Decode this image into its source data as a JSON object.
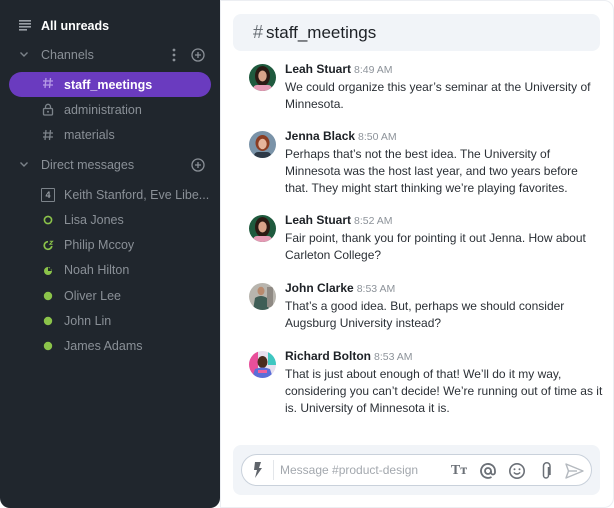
{
  "sidebar": {
    "all_unreads": {
      "label": "All unreads",
      "icon": "list-lines-icon"
    },
    "channels_section": {
      "label": "Channels",
      "icon": "chevron-down-icon"
    },
    "channels": [
      {
        "label": "staff_meetings",
        "icon": "hash-icon",
        "active": true
      },
      {
        "label": "administration",
        "icon": "lock-icon",
        "active": false
      },
      {
        "label": "materials",
        "icon": "hash-icon",
        "active": false
      }
    ],
    "dm_section": {
      "label": "Direct messages",
      "icon": "chevron-down-icon"
    },
    "direct_messages": [
      {
        "label": "Keith Stanford, Eve Libe...",
        "icon": "group-count-icon",
        "badge": "4"
      },
      {
        "label": "Lisa Jones",
        "icon": "status-away-ring-icon"
      },
      {
        "label": "Philip Mccoy",
        "icon": "status-snooze-icon"
      },
      {
        "label": "Noah Hilton",
        "icon": "status-dnd-icon"
      },
      {
        "label": "Oliver Lee",
        "icon": "status-online-dot-icon"
      },
      {
        "label": "John Lin",
        "icon": "status-online-dot-icon"
      },
      {
        "label": "James Adams",
        "icon": "status-online-dot-icon"
      }
    ]
  },
  "channel_header": {
    "hash": "#",
    "title": "staff_meetings"
  },
  "messages": [
    {
      "author": "Leah Stuart",
      "time": "8:49 AM",
      "lines": [
        "We could organize this year’s seminar at the University of",
        "Minnesota."
      ]
    },
    {
      "author": "Jenna Black",
      "time": "8:50 AM",
      "lines": [
        "Perhaps that’s not the best idea. The University of",
        "Minnesota was the host last year, and two years before",
        "that. They might start thinking we’re playing favorites."
      ]
    },
    {
      "author": "Leah Stuart",
      "time": "8:52 AM",
      "lines": [
        "Fair point, thank you for pointing it out Jenna. How about",
        "Carleton College?"
      ]
    },
    {
      "author": "John Clarke",
      "time": "8:53 AM",
      "lines": [
        "That’s a good idea. But, perhaps we should consider",
        "Augsburg University instead?"
      ]
    },
    {
      "author": "Richard Bolton",
      "time": "8:53 AM",
      "lines": [
        "That is just about enough of that! We’ll do it my way,",
        "considering you can’t decide! We’re running out of time as it",
        "is. University of Minnesota it is."
      ]
    }
  ],
  "composer": {
    "placeholder": "Message #product-design",
    "value": "",
    "text_format_label": "Tᴛ"
  },
  "colors": {
    "sidebar_bg": "#20262d",
    "active_channel": "#6a3bbf",
    "status_green": "#8bc34a",
    "header_bg": "#f1f4f8"
  }
}
